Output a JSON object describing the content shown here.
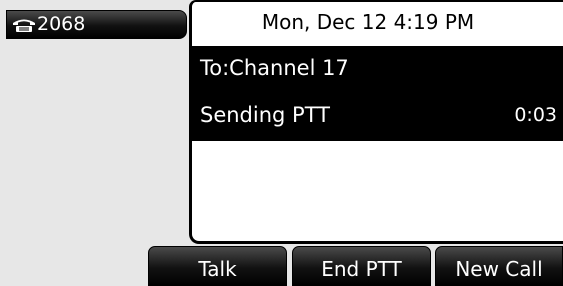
{
  "line_key": {
    "icon": "phone-icon",
    "label": "2068"
  },
  "status_bar": {
    "datetime": "Mon, Dec 12  4:19 PM"
  },
  "call": {
    "destination": "To:Channel 17",
    "state": "Sending PTT",
    "timer": "0:03"
  },
  "softkeys": [
    {
      "label": "Talk"
    },
    {
      "label": "End PTT"
    },
    {
      "label": "New Call"
    }
  ],
  "colors": {
    "background": "#e7e7e7",
    "highlight": "#000000",
    "text_on_dark": "#ffffff",
    "panel": "#ffffff"
  }
}
